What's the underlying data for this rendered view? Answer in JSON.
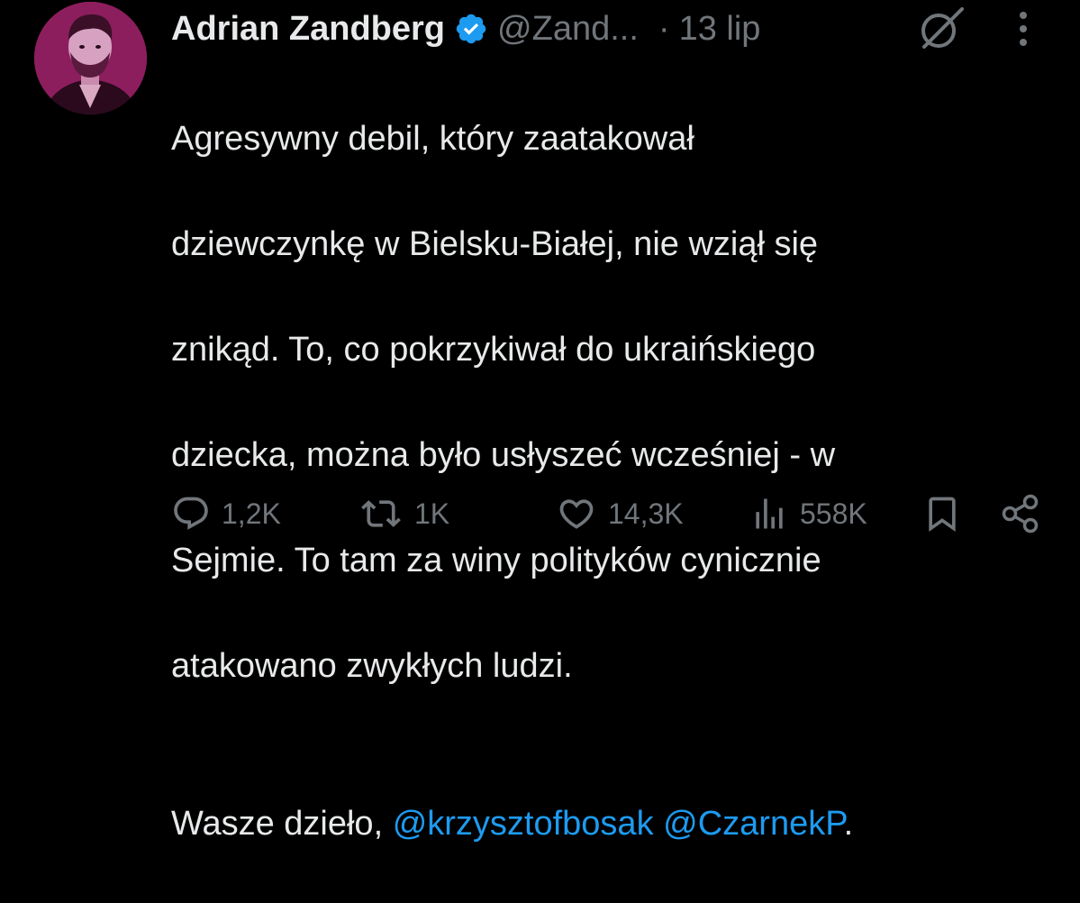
{
  "tweet": {
    "author": {
      "display_name": "Adrian Zandberg",
      "handle": "@Zand...",
      "verified": true,
      "avatar_color": "#8d1e5e"
    },
    "separator": "·",
    "date": "13 lip",
    "body": {
      "lines": [
        "Agresywny debil, który zaatakował",
        "dziewczynkę w Bielsku-Białej, nie wziął się",
        "znikąd. To, co pokrzykiwał do ukraińskiego",
        "dziecka, można było usłyszeć wcześniej - w",
        "Sejmie. To tam za winy polityków cynicznie",
        "atakowano zwykłych ludzi."
      ],
      "closing_prefix": "Wasze dzieło, ",
      "mention_1": "@krzysztofbosak",
      "mention_space": " ",
      "mention_2": "@CzarnekP",
      "closing_suffix": "."
    },
    "actions": {
      "replies": "1,2K",
      "reposts": "1K",
      "likes": "14,3K",
      "views": "558K"
    },
    "icons": {
      "verified": "verified-badge-icon",
      "grok": "grok-icon",
      "more": "more-vertical-icon",
      "reply": "reply-icon",
      "repost": "repost-icon",
      "like": "heart-icon",
      "views": "views-chart-icon",
      "bookmark": "bookmark-icon",
      "share": "share-icon"
    },
    "colors": {
      "background": "#000000",
      "text": "#e7e9ea",
      "secondary": "#71767b",
      "link": "#1d9bf0",
      "verified": "#1d9bf0"
    }
  }
}
